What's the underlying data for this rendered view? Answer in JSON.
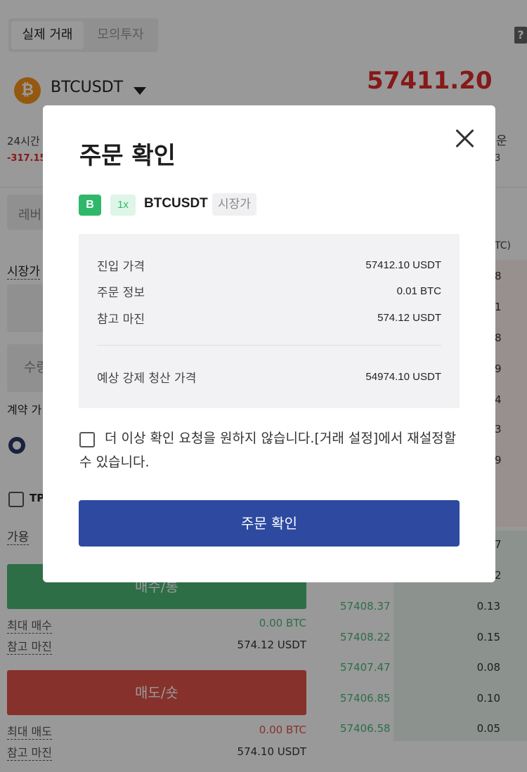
{
  "background": {
    "mode_tabs": {
      "active": "실제 거래",
      "inactive": "모의투자"
    },
    "help_icon": "?",
    "symbol": "BTCUSDT",
    "last_price": "57411.20",
    "stat_label": "24시간",
    "stat_change": "-317.15",
    "stat_right": "운",
    "stat_right2": "3",
    "leverage_label": "레버",
    "unit_header": "TC)",
    "order_type": "시장가",
    "quantity_label": "수량",
    "contract_label": "계약 가",
    "tpsl_label": "TP",
    "available_label": "가용",
    "buy_button": "매수/롱",
    "sell_button": "매도/숏",
    "max_buy_label": "최대 매수",
    "max_buy_value": "0.00 BTC",
    "buy_margin_label": "참고 마진",
    "buy_margin_value": "574.12 USDT",
    "max_sell_label": "최대 매도",
    "max_sell_value": "0.00 BTC",
    "sell_margin_label": "참고 마진",
    "sell_margin_value": "574.10 USDT",
    "orderbook_ask_edge": [
      "8",
      "1",
      "8",
      "9",
      "4",
      "3",
      "9"
    ],
    "orderbook_bid_edge": [
      "7",
      "2"
    ],
    "orderbook_bids": [
      {
        "price": "57408.37",
        "qty": "0.13"
      },
      {
        "price": "57408.22",
        "qty": "0.15"
      },
      {
        "price": "57407.47",
        "qty": "0.08"
      },
      {
        "price": "57406.85",
        "qty": "0.10"
      },
      {
        "price": "57406.58",
        "qty": "0.05"
      }
    ]
  },
  "modal": {
    "title": "주문 확인",
    "side_badge": "B",
    "leverage_badge": "1x",
    "symbol": "BTCUSDT",
    "order_type": "시장가",
    "rows": [
      {
        "label": "진입 가격",
        "value": "57412.10 USDT"
      },
      {
        "label": "주문 정보",
        "value": "0.01 BTC"
      },
      {
        "label": "참고 마진",
        "value": "574.12 USDT"
      }
    ],
    "liquidation": {
      "label": "예상 강제 청산 가격",
      "value": "54974.10 USDT"
    },
    "dont_ask_text": "더 이상 확인 요청을 원하지 않습니다.[거래 설정]에서 재설정할 수 있습니다.",
    "confirm_button": "주문 확인"
  },
  "colors": {
    "buy": "#4cb877",
    "sell": "#e05348",
    "price_red": "#e02b2b",
    "confirm": "#2d4aa0",
    "badge_green": "#2fb86a"
  }
}
